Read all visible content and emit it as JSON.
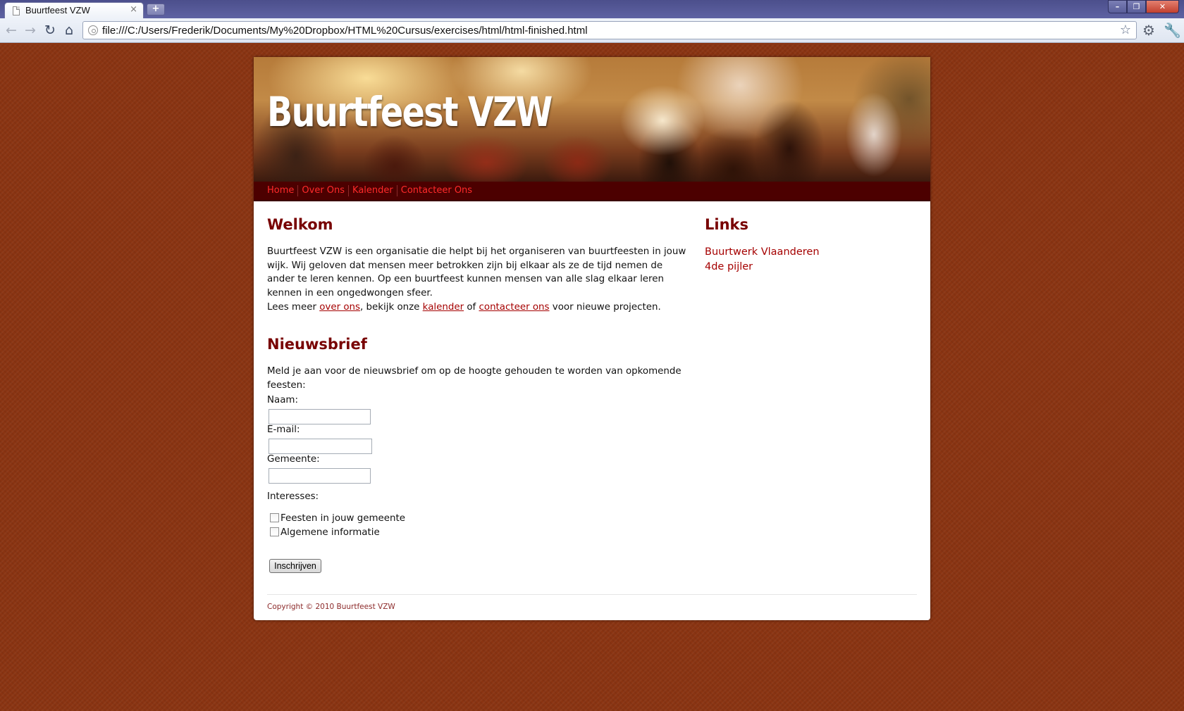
{
  "browser": {
    "tab_title": "Buurtfeest VZW",
    "tab_close": "×",
    "new_tab": "+",
    "url": "file:///C:/Users/Frederik/Documents/My%20Dropbox/HTML%20Cursus/exercises/html/html-finished.html",
    "window_buttons": {
      "minimize": "–",
      "maximize": "❐",
      "close": "✕"
    },
    "icons": [
      "back-icon",
      "forward-icon",
      "reload-icon",
      "home-icon",
      "star-icon",
      "page-menu-icon",
      "wrench-icon"
    ]
  },
  "site": {
    "title": "Buurtfeest VZW",
    "nav": [
      "Home",
      "Over Ons",
      "Kalender",
      "Contacteer Ons"
    ]
  },
  "welcome": {
    "heading": "Welkom",
    "intro": "Buurtfeest VZW is een organisatie die helpt bij het organiseren van buurtfeesten in jouw wijk. Wij geloven dat mensen meer betrokken zijn bij elkaar als ze de tijd nemen de ander te leren kennen. Op een buurtfeest kunnen mensen van alle slag elkaar leren kennen in een ongedwongen sfeer.",
    "more": {
      "prefix": "Lees meer ",
      "link1": "over ons",
      "mid1": ", bekijk onze ",
      "link2": "kalender",
      "mid2": " of ",
      "link3": "contacteer ons",
      "suffix": " voor nieuwe projecten."
    }
  },
  "newsletter": {
    "heading": "Nieuwsbrief",
    "intro": "Meld je aan voor de nieuwsbrief om op de hoogte gehouden te worden van opkomende feesten:",
    "name_label": "Naam:",
    "name_value": "",
    "email_label": "E-mail:",
    "email_value": "",
    "city_label": "Gemeente:",
    "city_value": "",
    "interests_label": "Interesses:",
    "interests": [
      {
        "label": "Feesten in jouw gemeente",
        "checked": false
      },
      {
        "label": "Algemene informatie",
        "checked": false
      }
    ],
    "submit": "Inschrijven"
  },
  "links": {
    "heading": "Links",
    "items": [
      "Buurtwerk Vlaanderen",
      "4de pijler"
    ]
  },
  "footer": {
    "copyright": "Copyright © 2010 Buurtfeest VZW"
  },
  "colors": {
    "page_background": "#8a3412",
    "nav_bar": "#4c0000",
    "nav_link": "#ff2a2a",
    "heading": "#780000",
    "link": "#a50000"
  }
}
